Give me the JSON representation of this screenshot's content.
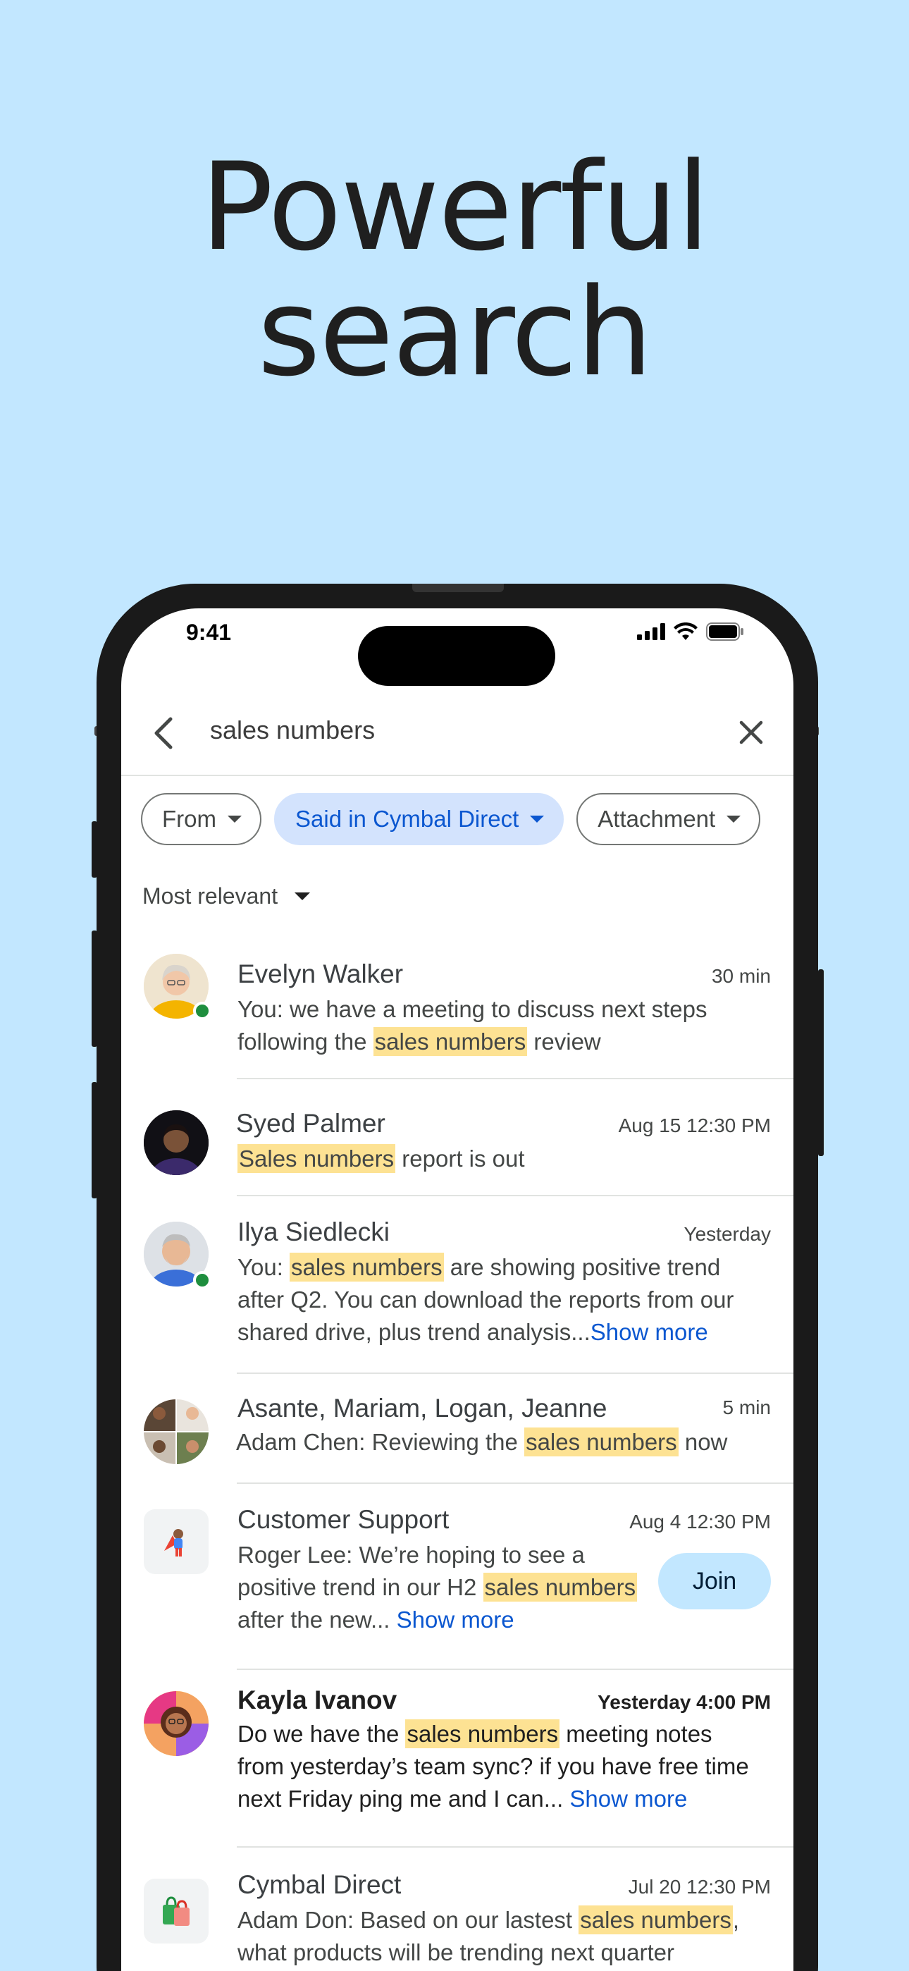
{
  "headline": {
    "line1": "Powerful",
    "line2": "search"
  },
  "status": {
    "time": "9:41"
  },
  "search": {
    "query": "sales numbers"
  },
  "chips": [
    {
      "label": "From"
    },
    {
      "label": "Said in Cymbal Direct"
    },
    {
      "label": "Attachment"
    }
  ],
  "sort": {
    "label": "Most relevant"
  },
  "results": [
    {
      "name": "Evelyn Walker",
      "time": "30 min",
      "pre": "You: we have a meeting to discuss next steps following the ",
      "hl": "sales numbers",
      "post": " review"
    },
    {
      "name": "Syed Palmer",
      "time": "Aug 15 12:30 PM",
      "hl": "Sales numbers",
      "post": " report is out"
    },
    {
      "name": "Ilya Siedlecki",
      "time": "Yesterday",
      "pre": "You: ",
      "hl": "sales numbers",
      "post": " are showing positive trend after Q2. You can download the reports from our shared drive, plus trend analysis...",
      "more": "Show more"
    },
    {
      "name": "Asante, Mariam, Logan, Jeanne",
      "time": "5 min",
      "pre": "Adam Chen: Reviewing the ",
      "hl": "sales numbers",
      "post": " now"
    },
    {
      "name": "Customer Support",
      "time": "Aug 4 12:30 PM",
      "line1": "Roger Lee: We’re hoping to see a",
      "line2pre": "positive trend in our H2 ",
      "hl": "sales numbers",
      "line3": "after the new... ",
      "more": "Show more",
      "button": "Join"
    },
    {
      "name": "Kayla Ivanov",
      "time": "Yesterday 4:00 PM",
      "pre": "Do we have the ",
      "hl": "sales numbers",
      "post": " meeting notes from yesterday’s team sync? if you have free time next Friday ping me and I can... ",
      "more": "Show more"
    },
    {
      "name": "Cymbal Direct",
      "time": "Jul 20 12:30 PM",
      "pre": "Adam Don: Based on our lastest ",
      "hl": "sales numbers",
      "post": ", what products will be trending next quarter"
    }
  ]
}
